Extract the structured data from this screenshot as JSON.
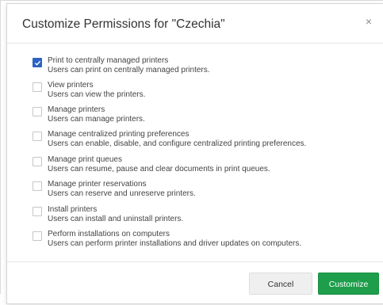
{
  "dialog": {
    "title": "Customize Permissions for \"Czechia\"",
    "close_glyph": "×",
    "close_icon": "close-icon"
  },
  "permissions": [
    {
      "name": "Print to centrally managed printers",
      "description": "Users can print on centrally managed printers.",
      "checked": true
    },
    {
      "name": "View printers",
      "description": "Users can view the printers.",
      "checked": false
    },
    {
      "name": "Manage printers",
      "description": "Users can manage printers.",
      "checked": false
    },
    {
      "name": "Manage centralized printing preferences",
      "description": "Users can enable, disable, and configure centralized printing preferences.",
      "checked": false
    },
    {
      "name": "Manage print queues",
      "description": "Users can resume, pause and clear documents in print queues.",
      "checked": false
    },
    {
      "name": "Manage printer reservations",
      "description": "Users can reserve and unreserve printers.",
      "checked": false
    },
    {
      "name": "Install printers",
      "description": "Users can install and uninstall printers.",
      "checked": false
    },
    {
      "name": "Perform installations on computers",
      "description": "Users can perform printer installations and driver updates on computers.",
      "checked": false
    }
  ],
  "footer": {
    "cancel_label": "Cancel",
    "customize_label": "Customize"
  },
  "colors": {
    "checkbox_checked": "#2a63c1",
    "primary_button": "#1e9e4b",
    "secondary_button": "#efefef"
  }
}
